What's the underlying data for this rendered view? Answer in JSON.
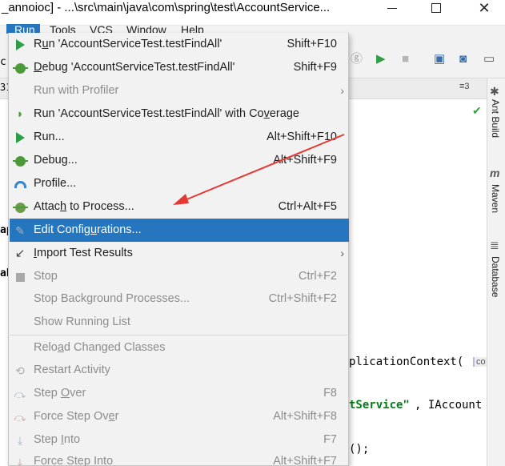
{
  "window": {
    "title": "_annoioc] - ...\\src\\main\\java\\com\\spring\\test\\AccountService...",
    "minimize": "—",
    "maximize": "☐",
    "close": "✕"
  },
  "menubar": {
    "run": "Run",
    "tools": "Tools",
    "vcs": "VCS",
    "window": "Window",
    "help": "Help"
  },
  "toolbar": {
    "icons": [
      "ⓖ",
      "▶",
      "■",
      "▣",
      "◙",
      "▭"
    ],
    "tab_count": "≡3"
  },
  "editor": {
    "gutter": [
      "c",
      "31",
      "ap",
      "ab"
    ],
    "line1": "plicationContext(",
    "line1_hint": "co",
    "line2_str": "tService\"",
    "line2_rest": ", IAccount",
    "line3": "();"
  },
  "right_tools": {
    "ant_build": "Ant Build",
    "maven": "Maven",
    "database": "Database"
  },
  "menu": {
    "items": [
      {
        "label_pre": "R",
        "label_mn": "u",
        "label_post": "n 'AccountServiceTest.testFindAll'",
        "shortcut": "Shift+F10"
      },
      {
        "label_pre": "",
        "label_mn": "D",
        "label_post": "ebug 'AccountServiceTest.testFindAll'",
        "shortcut": "Shift+F9"
      },
      {
        "label_pre": "Run with Profiler",
        "label_mn": "",
        "label_post": "",
        "shortcut": ""
      },
      {
        "label_pre": "Run 'AccountServiceTest.testFindAll' with Co",
        "label_mn": "v",
        "label_post": "erage",
        "shortcut": ""
      },
      {
        "label_pre": "Run...",
        "label_mn": "",
        "label_post": "",
        "shortcut": "Alt+Shift+F10"
      },
      {
        "label_pre": "Debug...",
        "label_mn": "",
        "label_post": "",
        "shortcut": "Alt+Shift+F9"
      },
      {
        "label_pre": "Profile...",
        "label_mn": "",
        "label_post": "",
        "shortcut": ""
      },
      {
        "label_pre": "Attac",
        "label_mn": "h",
        "label_post": " to Process...",
        "shortcut": "Ctrl+Alt+F5"
      },
      {
        "label_pre": "Edit Config",
        "label_mn": "u",
        "label_post": "rations...",
        "shortcut": ""
      },
      {
        "label_pre": "",
        "label_mn": "I",
        "label_post": "mport Test Results",
        "shortcut": ""
      },
      {
        "label_pre": "Stop",
        "label_mn": "",
        "label_post": "",
        "shortcut": "Ctrl+F2"
      },
      {
        "label_pre": "Stop Background Processes...",
        "label_mn": "",
        "label_post": "",
        "shortcut": "Ctrl+Shift+F2"
      },
      {
        "label_pre": "Show Running List",
        "label_mn": "",
        "label_post": "",
        "shortcut": ""
      },
      {
        "label_pre": "Relo",
        "label_mn": "a",
        "label_post": "d Changed Classes",
        "shortcut": ""
      },
      {
        "label_pre": "Restart Activity",
        "label_mn": "",
        "label_post": "",
        "shortcut": ""
      },
      {
        "label_pre": "Step ",
        "label_mn": "O",
        "label_post": "ver",
        "shortcut": "F8"
      },
      {
        "label_pre": "Force Step Ov",
        "label_mn": "e",
        "label_post": "r",
        "shortcut": "Alt+Shift+F8"
      },
      {
        "label_pre": "Step ",
        "label_mn": "I",
        "label_post": "nto",
        "shortcut": "F7"
      },
      {
        "label_pre": "Force Step Into",
        "label_mn": "",
        "label_post": "",
        "shortcut": "Alt+Shift+F7"
      }
    ]
  },
  "colors": {
    "selection": "#2675bf",
    "menu_bg": "#f2f2f2",
    "annotation_arrow": "#e53935"
  }
}
